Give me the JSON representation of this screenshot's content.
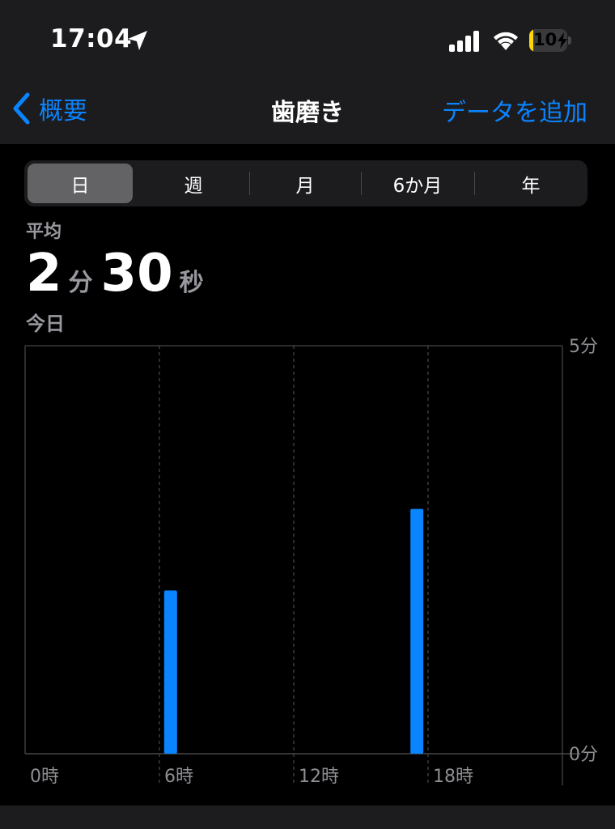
{
  "status_bar": {
    "time": "17:04",
    "battery_label": "10",
    "battery_level": 0.1,
    "icons": [
      "location-arrow-icon",
      "cellular-signal-icon",
      "wifi-icon",
      "battery-icon",
      "charging-bolt-icon"
    ]
  },
  "nav": {
    "back_label": "概要",
    "title": "歯磨き",
    "add_label": "データを追加"
  },
  "segments": [
    {
      "label": "日",
      "selected": true
    },
    {
      "label": "週",
      "selected": false
    },
    {
      "label": "月",
      "selected": false
    },
    {
      "label": "6か月",
      "selected": false
    },
    {
      "label": "年",
      "selected": false
    }
  ],
  "summary": {
    "avg_label": "平均",
    "minutes": "2",
    "minutes_unit": "分",
    "seconds": "30",
    "seconds_unit": "秒",
    "date_label": "今日"
  },
  "colors": {
    "accent": "#0a84ff",
    "bar": "#0a84ff",
    "background": "#000000",
    "header": "#1c1c1e",
    "secondary_text": "#98989f"
  },
  "chart_data": {
    "type": "bar",
    "x_ticks": [
      {
        "value": 0,
        "label": "0時"
      },
      {
        "value": 6,
        "label": "6時"
      },
      {
        "value": 12,
        "label": "12時"
      },
      {
        "value": 18,
        "label": "18時"
      }
    ],
    "y_ticks": [
      {
        "value": 0,
        "label": "0分"
      },
      {
        "value": 5,
        "label": "5分"
      }
    ],
    "xlim": [
      0,
      24
    ],
    "ylim": [
      0,
      5
    ],
    "series": [
      {
        "x": [
          6.5,
          17.5
        ],
        "values": [
          2.0,
          3.0
        ]
      }
    ],
    "grid": true,
    "title": "",
    "xlabel": "",
    "ylabel": ""
  }
}
